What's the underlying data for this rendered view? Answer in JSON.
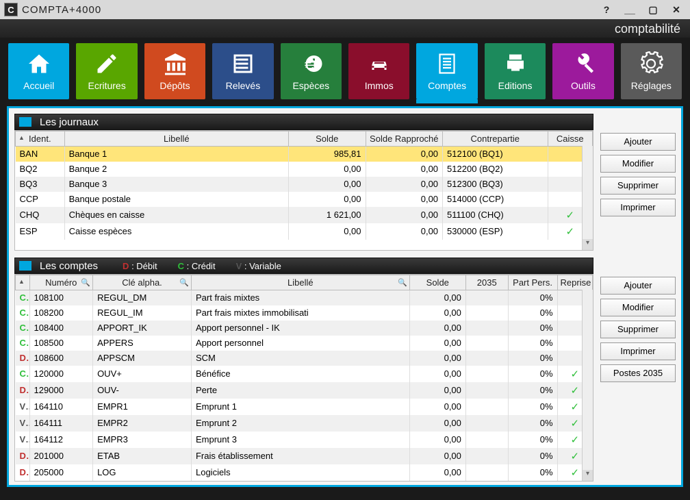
{
  "app": {
    "title": "COMPTA+4000",
    "icon_letter": "C",
    "subtitle": "comptabilité"
  },
  "toolbar": [
    {
      "id": "accueil",
      "label": "Accueil"
    },
    {
      "id": "ecritures",
      "label": "Ecritures"
    },
    {
      "id": "depots",
      "label": "Dépôts"
    },
    {
      "id": "releves",
      "label": "Relevés"
    },
    {
      "id": "especes",
      "label": "Espèces"
    },
    {
      "id": "immos",
      "label": "Immos"
    },
    {
      "id": "comptes",
      "label": "Comptes",
      "active": true
    },
    {
      "id": "editions",
      "label": "Editions"
    },
    {
      "id": "outils",
      "label": "Outils"
    },
    {
      "id": "reglages",
      "label": "Réglages"
    }
  ],
  "journaux": {
    "title": "Les journaux",
    "cols": {
      "ident": "Ident.",
      "libelle": "Libellé",
      "solde": "Solde",
      "solde_r": "Solde Rapproché",
      "contrepartie": "Contrepartie",
      "caisse": "Caisse"
    },
    "rows": [
      {
        "ident": "BAN",
        "libelle": "Banque 1",
        "solde": "985,81",
        "solde_r": "0,00",
        "cp": "512100 (BQ1)",
        "caisse": false,
        "selected": true
      },
      {
        "ident": "BQ2",
        "libelle": "Banque 2",
        "solde": "0,00",
        "solde_r": "0,00",
        "cp": "512200 (BQ2)",
        "caisse": false
      },
      {
        "ident": "BQ3",
        "libelle": "Banque 3",
        "solde": "0,00",
        "solde_r": "0,00",
        "cp": "512300 (BQ3)",
        "caisse": false
      },
      {
        "ident": "CCP",
        "libelle": "Banque postale",
        "solde": "0,00",
        "solde_r": "0,00",
        "cp": "514000 (CCP)",
        "caisse": false
      },
      {
        "ident": "CHQ",
        "libelle": "Chèques en caisse",
        "solde": "1 621,00",
        "solde_r": "0,00",
        "cp": "511100 (CHQ)",
        "caisse": true
      },
      {
        "ident": "ESP",
        "libelle": "Caisse espèces",
        "solde": "0,00",
        "solde_r": "0,00",
        "cp": "530000 (ESP)",
        "caisse": true
      }
    ],
    "buttons": {
      "add": "Ajouter",
      "edit": "Modifier",
      "del": "Supprimer",
      "print": "Imprimer"
    }
  },
  "comptes": {
    "title": "Les comptes",
    "legend": {
      "d": "D",
      "d_txt": ": Débit",
      "c": "C",
      "c_txt": ": Crédit",
      "v": "V",
      "v_txt": ": Variable"
    },
    "cols": {
      "numero": "Numéro",
      "cle": "Clé alpha.",
      "libelle": "Libellé",
      "solde": "Solde",
      "y2035": "2035",
      "partpers": "Part Pers.",
      "reprise": "Reprise"
    },
    "rows": [
      {
        "cls": "C",
        "num": "108100",
        "cle": "REGUL_DM",
        "lib": "Part frais mixtes",
        "solde": "0,00",
        "y2035": "",
        "pp": "0%",
        "rep": false
      },
      {
        "cls": "C",
        "num": "108200",
        "cle": "REGUL_IM",
        "lib": "Part frais mixtes immobilisati",
        "solde": "0,00",
        "y2035": "",
        "pp": "0%",
        "rep": false
      },
      {
        "cls": "C",
        "num": "108400",
        "cle": "APPORT_IK",
        "lib": "Apport personnel - IK",
        "solde": "0,00",
        "y2035": "",
        "pp": "0%",
        "rep": false
      },
      {
        "cls": "C",
        "num": "108500",
        "cle": "APPERS",
        "lib": "Apport personnel",
        "solde": "0,00",
        "y2035": "",
        "pp": "0%",
        "rep": false
      },
      {
        "cls": "D",
        "num": "108600",
        "cle": "APPSCM",
        "lib": "SCM",
        "solde": "0,00",
        "y2035": "",
        "pp": "0%",
        "rep": false
      },
      {
        "cls": "C",
        "num": "120000",
        "cle": "OUV+",
        "lib": "Bénéfice",
        "solde": "0,00",
        "y2035": "",
        "pp": "0%",
        "rep": true
      },
      {
        "cls": "D",
        "num": "129000",
        "cle": "OUV-",
        "lib": "Perte",
        "solde": "0,00",
        "y2035": "",
        "pp": "0%",
        "rep": true
      },
      {
        "cls": "V",
        "num": "164110",
        "cle": "EMPR1",
        "lib": "Emprunt 1",
        "solde": "0,00",
        "y2035": "",
        "pp": "0%",
        "rep": true
      },
      {
        "cls": "V",
        "num": "164111",
        "cle": "EMPR2",
        "lib": "Emprunt 2",
        "solde": "0,00",
        "y2035": "",
        "pp": "0%",
        "rep": true
      },
      {
        "cls": "V",
        "num": "164112",
        "cle": "EMPR3",
        "lib": "Emprunt 3",
        "solde": "0,00",
        "y2035": "",
        "pp": "0%",
        "rep": true
      },
      {
        "cls": "D",
        "num": "201000",
        "cle": "ETAB",
        "lib": "Frais établissement",
        "solde": "0,00",
        "y2035": "",
        "pp": "0%",
        "rep": true
      },
      {
        "cls": "D",
        "num": "205000",
        "cle": "LOG",
        "lib": "Logiciels",
        "solde": "0,00",
        "y2035": "",
        "pp": "0%",
        "rep": true
      }
    ],
    "buttons": {
      "add": "Ajouter",
      "edit": "Modifier",
      "del": "Supprimer",
      "print": "Imprimer",
      "postes": "Postes 2035"
    }
  }
}
